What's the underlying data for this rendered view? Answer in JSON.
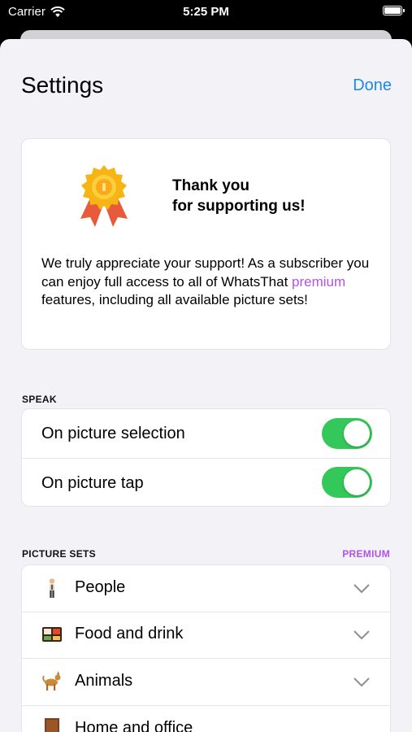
{
  "status": {
    "carrier": "Carrier",
    "time": "5:25 PM"
  },
  "nav": {
    "title": "Settings",
    "done_label": "Done"
  },
  "thanks": {
    "title_line1": "Thank you",
    "title_line2": "for supporting us!",
    "body_before": "We truly appreciate your support! As a subscriber you can enjoy full access to all of WhatsThat ",
    "body_highlight": "premium",
    "body_after": " features, including all available picture sets!"
  },
  "speak": {
    "header": "SPEAK",
    "items": [
      {
        "label": "On picture selection",
        "enabled": true
      },
      {
        "label": "On picture tap",
        "enabled": true
      }
    ]
  },
  "picture_sets": {
    "header": "PICTURE SETS",
    "premium_label": "PREMIUM",
    "items": [
      {
        "label": "People",
        "icon": "person-icon"
      },
      {
        "label": "Food and drink",
        "icon": "bento-box-icon"
      },
      {
        "label": "Animals",
        "icon": "dog-icon"
      },
      {
        "label": "Home and office",
        "icon": "door-icon"
      }
    ]
  },
  "colors": {
    "accent": "#1e88e5",
    "premium": "#b153e8",
    "toggle_on": "#34c759"
  }
}
